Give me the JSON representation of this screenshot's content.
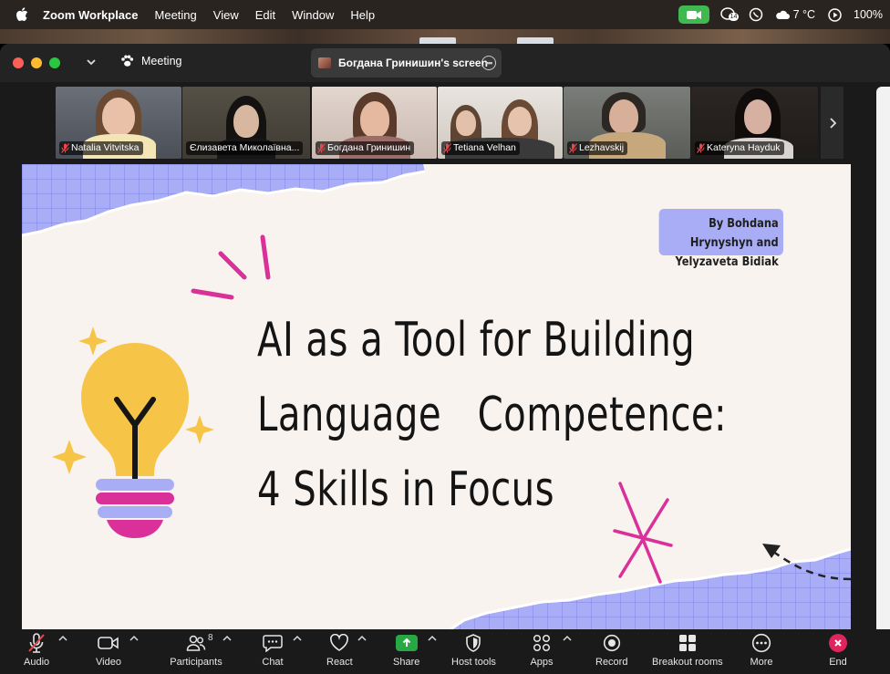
{
  "menubar": {
    "app_name": "Zoom Workplace",
    "menus": [
      "Meeting",
      "View",
      "Edit",
      "Window",
      "Help"
    ],
    "weather": "7 °C",
    "battery": "100%",
    "badge_count": "14"
  },
  "window": {
    "meeting_label": "Meeting",
    "screen_tab_label": "Богдана Гринишин's screen"
  },
  "participants": [
    {
      "name": "Natalia Vitvitska",
      "muted": true
    },
    {
      "name": "Єлизавета Миколаївна...",
      "muted": false,
      "active": true
    },
    {
      "name": "Богдана Гринишин",
      "muted": true
    },
    {
      "name": "Tetiana Velhan",
      "muted": true
    },
    {
      "name": "Lezhavskij",
      "muted": true
    },
    {
      "name": "Kateryna Hayduk",
      "muted": true
    }
  ],
  "slide": {
    "author_line1": "By Bohdana Hrynyshyn and",
    "author_line2": "Yelyzaveta Bidiak",
    "title_line1": "AI as a Tool for Building",
    "title_line2": "Language   Competence:",
    "title_line3": "4 Skills in Focus",
    "colors": {
      "background": "#f9f3ef",
      "lavender": "#a9adf6",
      "magenta": "#d9309a",
      "yellow": "#f6c548"
    }
  },
  "toolbar": {
    "audio": "Audio",
    "video": "Video",
    "participants": "Participants",
    "participants_count": "8",
    "chat": "Chat",
    "react": "React",
    "share": "Share",
    "host_tools": "Host tools",
    "apps": "Apps",
    "record": "Record",
    "breakout": "Breakout rooms",
    "more": "More",
    "end": "End"
  }
}
